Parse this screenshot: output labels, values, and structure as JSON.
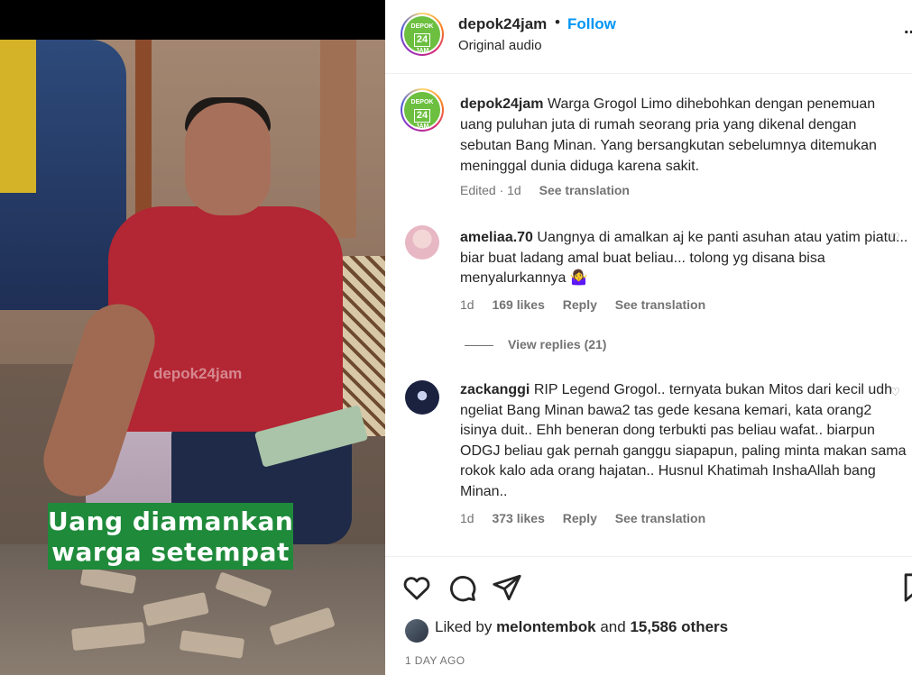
{
  "media": {
    "watermark": "depok24jam",
    "caption_line1": "Uang diamankan",
    "caption_line2": "warga setempat"
  },
  "header": {
    "username": "depok24jam",
    "separator": "•",
    "follow_label": "Follow",
    "audio": "Original audio",
    "more": "..."
  },
  "post": {
    "username": "depok24jam",
    "caption": "Warga Grogol Limo dihebohkan dengan penemuan uang puluhan juta di rumah seorang pria yang dikenal dengan sebutan Bang Minan. Yang bersangkutan sebelumnya ditemukan meninggal dunia diduga karena sakit.",
    "meta_edited": "Edited · 1d",
    "see_translation": "See translation"
  },
  "comments": [
    {
      "username": "ameliaa.70",
      "text": "Uangnya di amalkan aj ke panti asuhan atau yatim piatu... biar buat ladang amal buat beliau... tolong yg disana bisa menyalurkannya 🤷‍♀️",
      "age": "1d",
      "likes": "169 likes",
      "reply": "Reply",
      "see_translation": "See translation",
      "view_replies": "View replies (21)"
    },
    {
      "username": "zackanggi",
      "text": "RIP Legend Grogol.. ternyata bukan Mitos dari kecil udh ngeliat Bang Minan bawa2 tas gede kesana kemari, kata orang2 isinya duit.. Ehh beneran dong terbukti pas beliau wafat.. biarpun ODGJ beliau gak pernah ganggu siapapun, paling minta makan sama rokok kalo ada orang hajatan.. Husnul Khatimah InshaAllah bang Minan..",
      "age": "1d",
      "likes": "373 likes",
      "reply": "Reply",
      "see_translation": "See translation"
    }
  ],
  "actions": {
    "icons": [
      "heart-icon",
      "comment-icon",
      "share-icon",
      "bookmark-icon"
    ],
    "liked_by_prefix": "Liked by",
    "liked_by_user": "melontembok",
    "liked_and": "and",
    "liked_others": "15,586 others",
    "time": "1 DAY AGO"
  },
  "colors": {
    "link": "#0095f6",
    "secondary": "#737373",
    "text": "#262626",
    "caption_bg": "#1e8a3a",
    "logo_green": "#6cbf3f"
  }
}
